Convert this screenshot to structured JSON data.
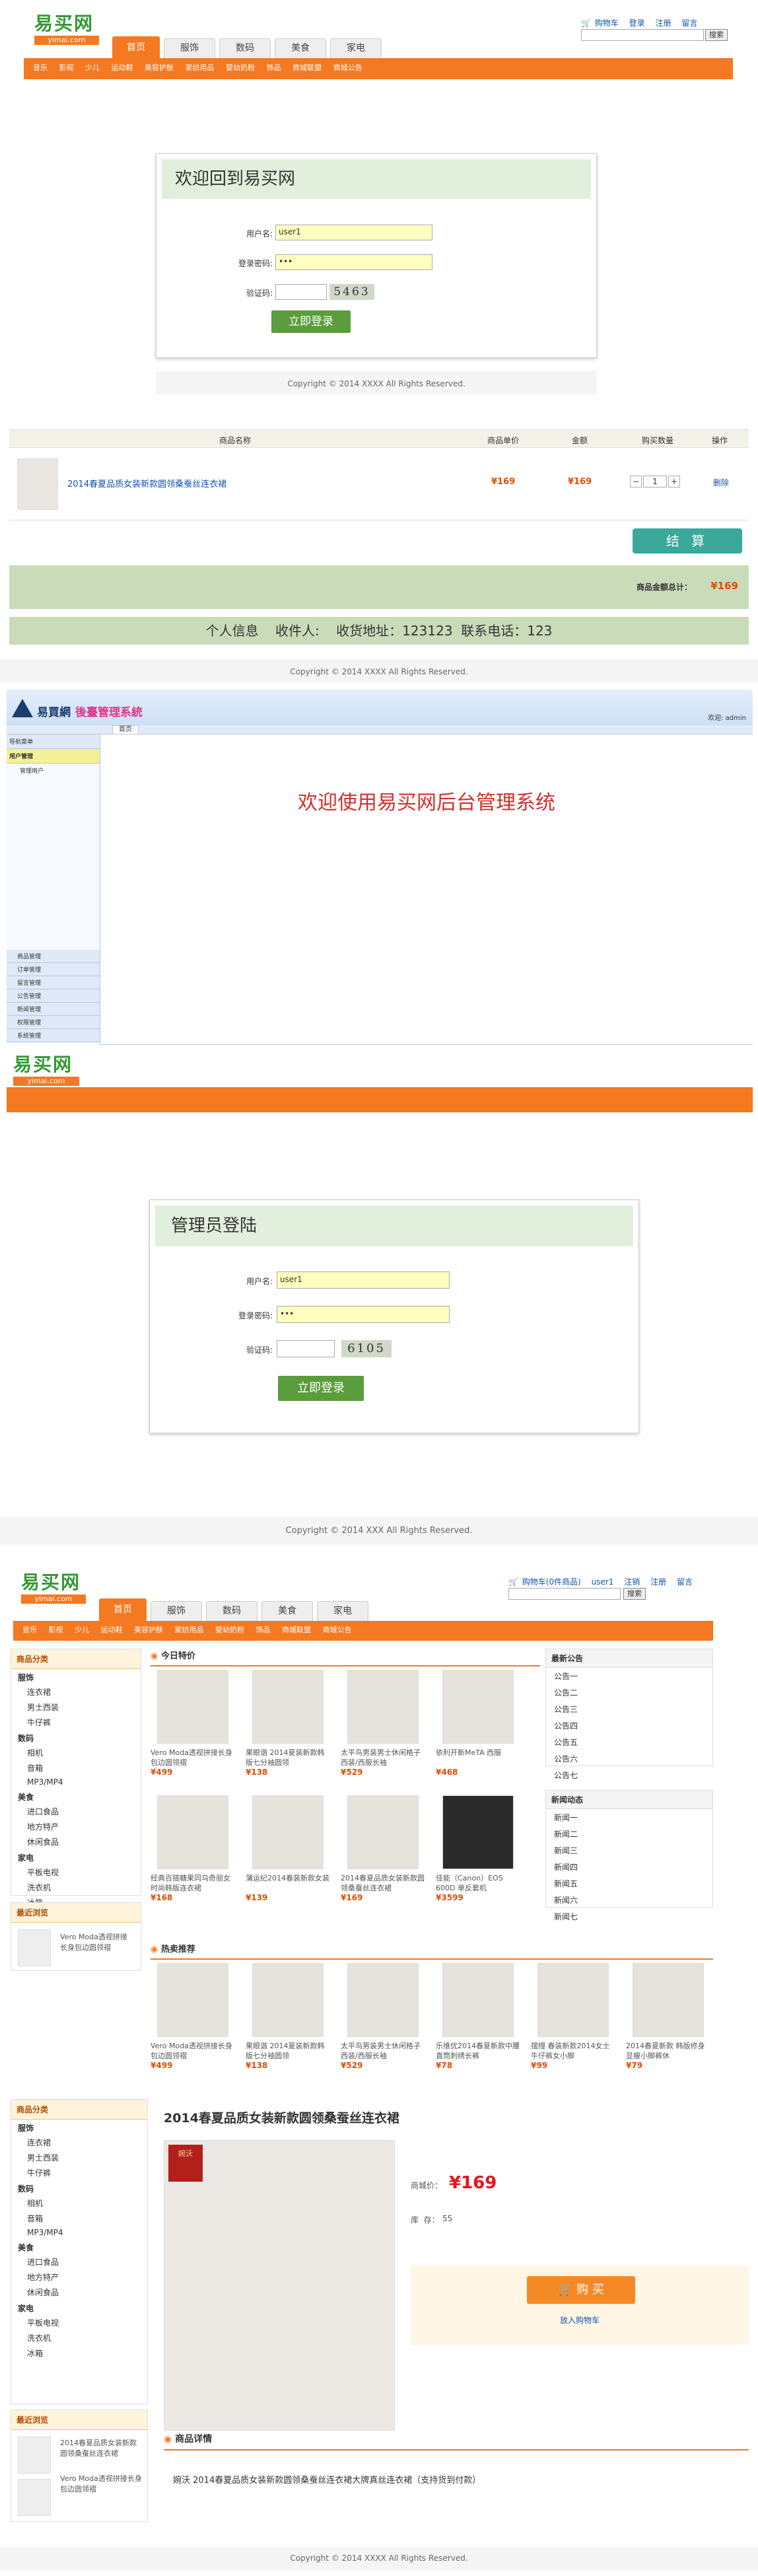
{
  "header1": {
    "logo": "易买网",
    "logo_url": "yimai.com",
    "links": [
      "购物车",
      "登录",
      "注册",
      "留言"
    ],
    "search_btn": "搜索",
    "tabs": [
      "首页",
      "服饰",
      "数码",
      "美食",
      "家电"
    ],
    "nav": [
      "音乐",
      "影视",
      "少儿",
      "运动鞋",
      "美容护肤",
      "家纺用品",
      "婴幼奶粉",
      "饰品",
      "商城联盟",
      "商城公告"
    ]
  },
  "login": {
    "title": "欢迎回到易买网",
    "user_label": "用户名:",
    "user_value": "user1",
    "pwd_label": "登录密码:",
    "pwd_value": "•••",
    "code_label": "验证码:",
    "code": "5463",
    "btn": "立即登录",
    "footer": "Copyright © 2014 XXXX All Rights Reserved."
  },
  "cart": {
    "headers": [
      "商品名称",
      "商品单价",
      "金额",
      "购买数量",
      "操作"
    ],
    "item": {
      "name": "2014春夏品质女装新款圆领桑蚕丝连衣裙",
      "price": "¥169",
      "amount": "¥169",
      "qty": "1",
      "op": "删除"
    },
    "checkout": "结 算",
    "total_label": "商品金额总计：",
    "total": "¥169",
    "info": "个人信息    收件人:    收货地址：123123  联系电话：123",
    "footer": "Copyright © 2014 XXXX All Rights Reserved."
  },
  "admin": {
    "title_pre": "易買網",
    "title_suf": "後臺管理系統",
    "welcome_user": "欢迎: admin",
    "nav": "首页",
    "side_head": "导航菜单",
    "side_item": "用户管理",
    "side_sub": "管理用户",
    "bottom_items": [
      "商品管理",
      "订单管理",
      "留言管理",
      "公告管理",
      "新闻管理",
      "权限管理",
      "系统管理"
    ],
    "main_text": "欢迎使用易买网后台管理系统"
  },
  "admin_login": {
    "logo": "易买网",
    "logo_url": "yimai.com",
    "title": "管理员登陆",
    "user_label": "用户名:",
    "user_value": "user1",
    "pwd_label": "登录密码:",
    "pwd_value": "•••",
    "code_label": "验证码:",
    "code": "6105",
    "btn": "立即登录",
    "footer": "Copyright © 2014 XXX All Rights Reserved."
  },
  "home": {
    "links": [
      "购物车(0件商品)",
      "user1",
      "注销",
      "注册",
      "留言"
    ],
    "search_btn": "搜索",
    "categories_title": "商品分类",
    "categories": [
      {
        "name": "服饰",
        "subs": [
          "连衣裙",
          "男士西装",
          "牛仔裤"
        ]
      },
      {
        "name": "数码",
        "subs": [
          "相机",
          "音箱",
          "MP3/MP4"
        ]
      },
      {
        "name": "美食",
        "subs": [
          "进口食品",
          "地方特产",
          "休闲食品"
        ]
      },
      {
        "name": "家电",
        "subs": [
          "平板电视",
          "洗衣机",
          "冰箱"
        ]
      }
    ],
    "recent_title": "最近浏览",
    "recent": [
      "Vero Moda透视拼接长身包边圆领褶"
    ],
    "deals_title": "今日特价",
    "deals": [
      {
        "name": "Vero Moda透视拼接长身包边圆领褶",
        "price": "¥499"
      },
      {
        "name": "果眼谐 2014夏装新款韩版七分袖圆领",
        "price": "¥138"
      },
      {
        "name": "太平鸟男装男士休闲格子西装/西服长袖",
        "price": "¥529"
      },
      {
        "name": "依利开新MeTA 西服",
        "price": "¥468"
      },
      {
        "name": "经典百搭糖果同乌奇丽女时尚韩版连衣裙",
        "price": "¥168"
      },
      {
        "name": "蒲运纪2014春装新款女装",
        "price": "¥139"
      },
      {
        "name": "2014春夏品质女装新款圆领桑蚕丝连衣裙",
        "price": "¥169"
      },
      {
        "name": "佳能（Canon）EOS 600D 单反套机",
        "price": "¥3599"
      }
    ],
    "notice_title": "最新公告",
    "notices": [
      "公告一",
      "公告二",
      "公告三",
      "公告四",
      "公告五",
      "公告六",
      "公告七"
    ],
    "news_title": "新闻动态",
    "news": [
      "新闻一",
      "新闻二",
      "新闻三",
      "新闻四",
      "新闻五",
      "新闻六",
      "新闻七"
    ],
    "hot_title": "热卖推荐",
    "hot": [
      {
        "name": "Vero Moda透视拼接长身包边圆领褶",
        "price": "¥499"
      },
      {
        "name": "果眼谐 2014夏装新款韩版七分袖圆领",
        "price": "¥138"
      },
      {
        "name": "太平鸟男装男士休闲格子西装/西服长袖",
        "price": "¥529"
      },
      {
        "name": "乐维优2014春夏新款中腰直筒刺绣长裤",
        "price": "¥78"
      },
      {
        "name": "摆缦 春装新款2014女士牛仔裤女小脚",
        "price": "¥99"
      },
      {
        "name": "2014春夏新款 韩版修身显瘦小脚裤休",
        "price": "¥79"
      }
    ]
  },
  "detail": {
    "categories_title": "商品分类",
    "recent_title": "最近浏览",
    "recent": [
      "2014春夏品质女装新款圆领桑蚕丝连衣裙",
      "Vero Moda透视拼接长身包边圆领褶"
    ],
    "title": "2014春夏品质女装新款圆领桑蚕丝连衣裙",
    "price_label": "商城价：",
    "price": "¥169",
    "stock_label": "库  存：",
    "stock": "55",
    "buy_btn": "购  买",
    "add_cart": "放入购物车",
    "tab": "商品详情",
    "desc": "婉沃 2014春夏品质女装新款圆领桑蚕丝连衣裙大牌真丝连衣裙（支持货到付款）",
    "brand": "婉沃",
    "footer": "Copyright © 2014 XXXX All Rights Reserved."
  },
  "colors": {
    "orange": "#f47920",
    "green": "#5a9d3c",
    "price": "#e44c00"
  }
}
